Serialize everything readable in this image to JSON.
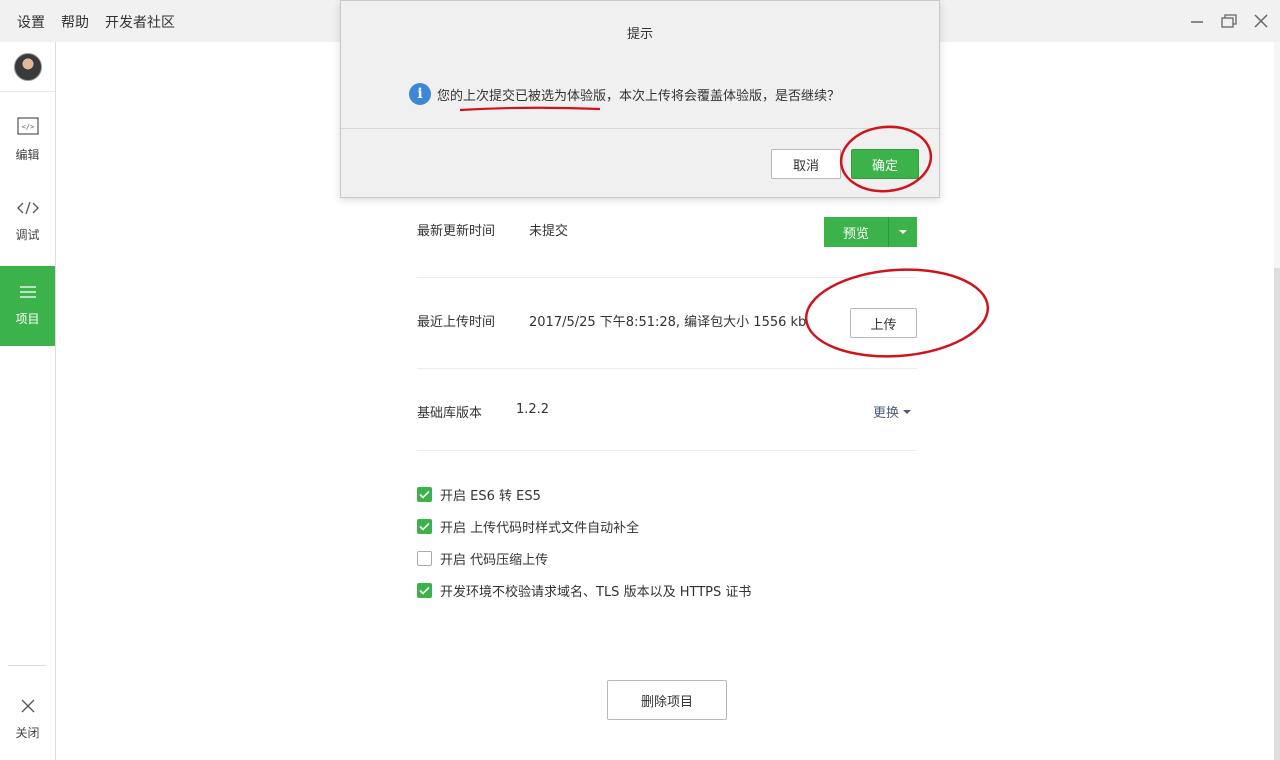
{
  "menu": {
    "settings": "设置",
    "help": "帮助",
    "community": "开发者社区"
  },
  "sidebar": {
    "items": [
      {
        "label": "编辑",
        "icon": "code-file-icon"
      },
      {
        "label": "调试",
        "icon": "code-brackets-icon"
      },
      {
        "label": "项目",
        "icon": "menu-lines-icon",
        "active": true
      }
    ],
    "close_label": "关闭"
  },
  "project": {
    "latest_update_label": "最新更新时间",
    "latest_update_value": "未提交",
    "preview_label": "预览",
    "recent_upload_label": "最近上传时间",
    "recent_upload_value": "2017/5/25 下午8:51:28, 编译包大小 1556 kb",
    "upload_label": "上传",
    "lib_version_label": "基础库版本",
    "lib_version_value": "1.2.2",
    "change_label": "更换",
    "options": [
      {
        "label": "开启 ES6 转 ES5",
        "checked": true
      },
      {
        "label": "开启 上传代码时样式文件自动补全",
        "checked": true
      },
      {
        "label": "开启 代码压缩上传",
        "checked": false
      },
      {
        "label": "开发环境不校验请求域名、TLS 版本以及 HTTPS 证书",
        "checked": true
      }
    ],
    "delete_label": "删除项目"
  },
  "dialog": {
    "title": "提示",
    "message": "您的上次提交已被选为体验版，本次上传将会覆盖体验版，是否继续？",
    "cancel_label": "取消",
    "confirm_label": "确定"
  },
  "colors": {
    "accent_green": "#3cb34a",
    "annotation_red": "#d0141c",
    "info_blue": "#3e86d6"
  }
}
